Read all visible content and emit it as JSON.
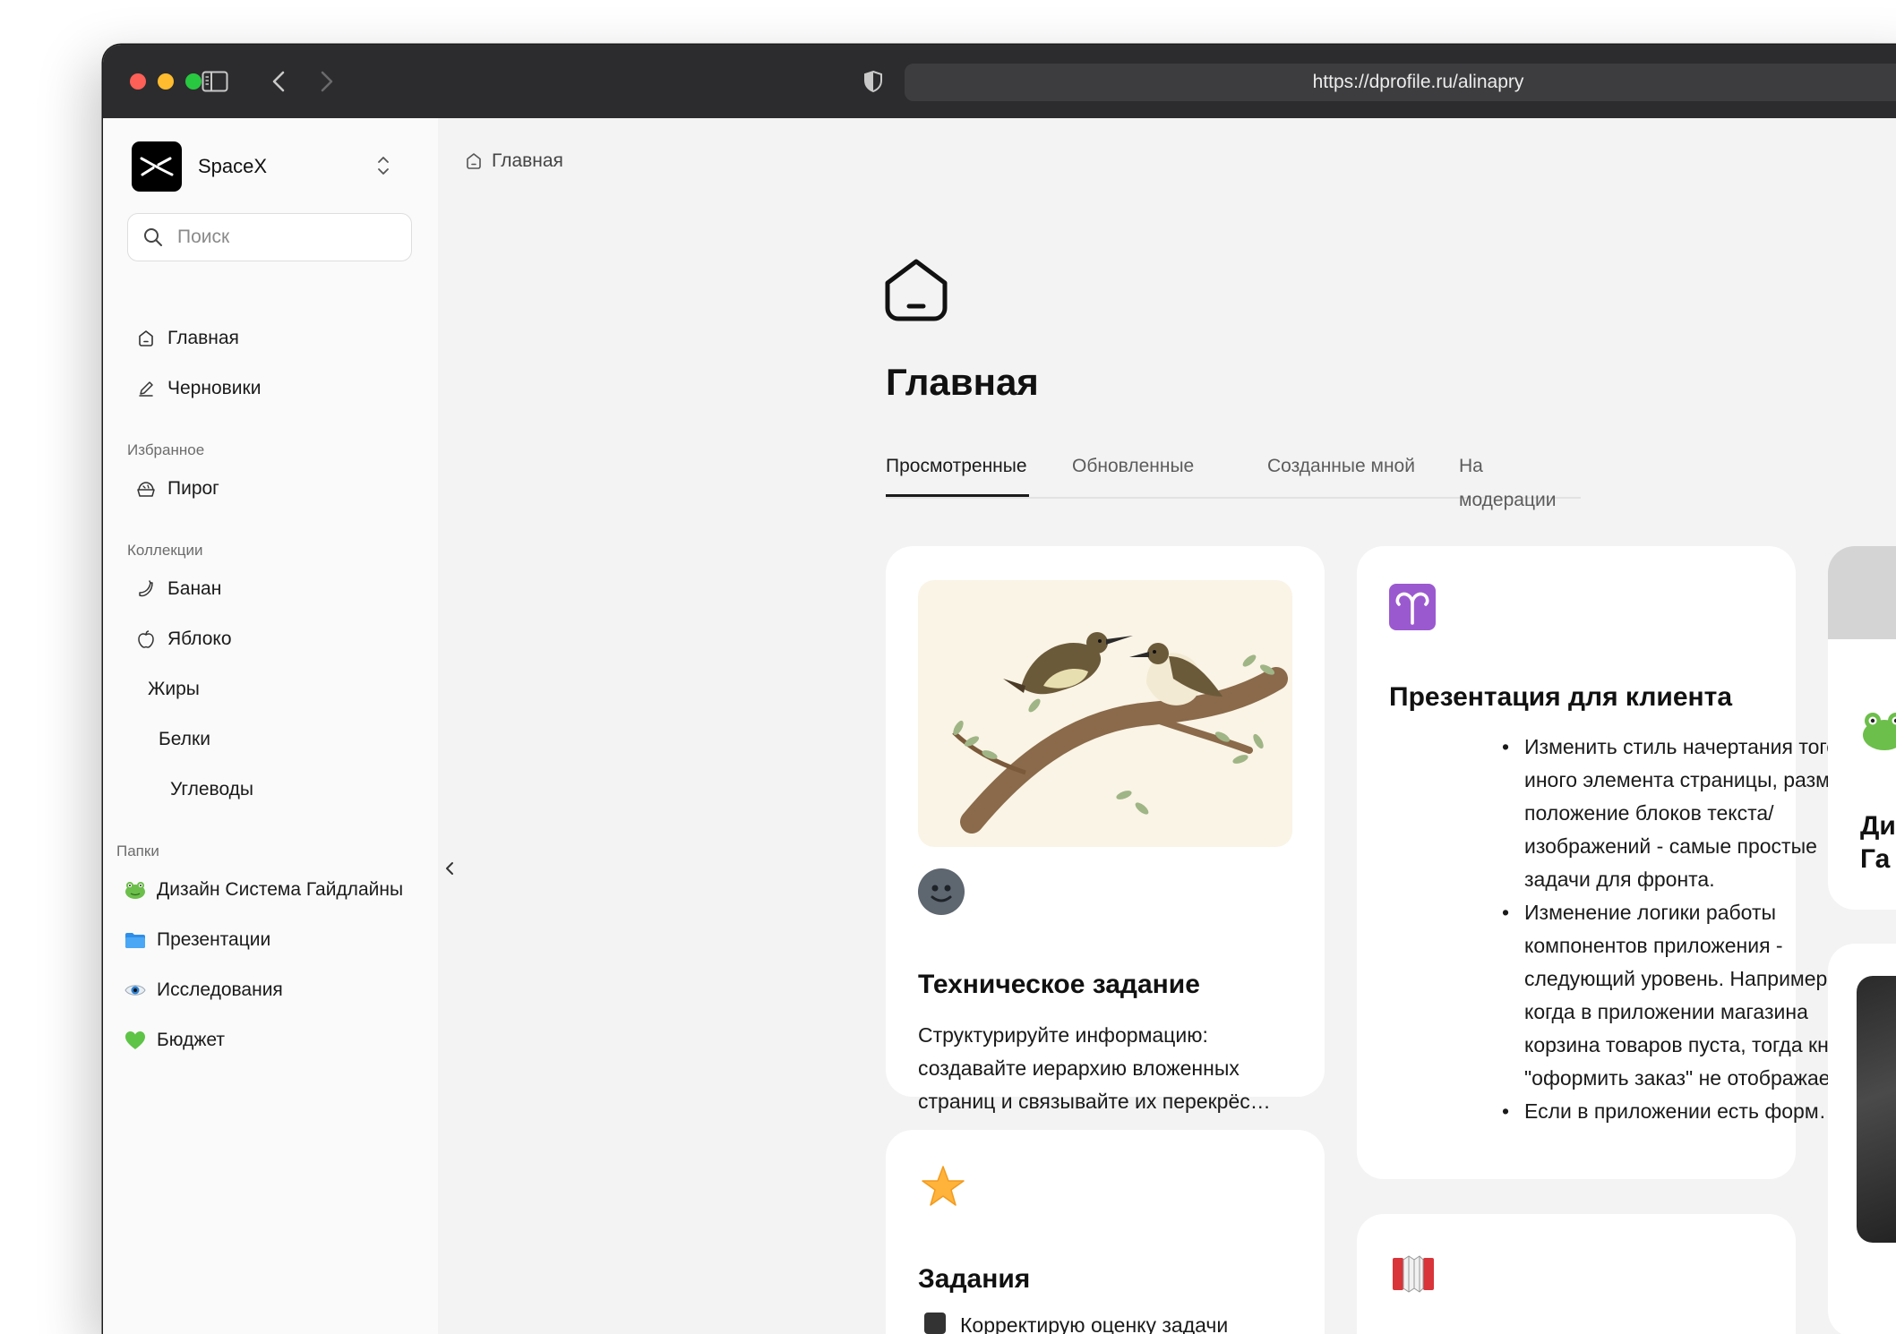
{
  "browser": {
    "url": "https://dprofile.ru/alinapry"
  },
  "sidebar": {
    "workspace": {
      "name": "SpaceX",
      "logo_icon": "x-logo"
    },
    "search": {
      "placeholder": "Поиск"
    },
    "main_items": [
      {
        "label": "Главная",
        "icon": "home-icon"
      },
      {
        "label": "Черновики",
        "icon": "pencil-icon"
      }
    ],
    "favorites": {
      "title": "Избранное",
      "items": [
        {
          "label": "Пирог",
          "icon": "pie-icon"
        }
      ]
    },
    "collections": {
      "title": "Коллекции",
      "items": [
        {
          "label": "Банан",
          "icon": "banana-icon"
        },
        {
          "label": "Яблоко",
          "icon": "apple-icon"
        },
        {
          "label": "Жиры"
        },
        {
          "label": "Белки"
        },
        {
          "label": "Углеводы"
        }
      ]
    },
    "folders": {
      "title": "Папки",
      "items": [
        {
          "label": "Дизайн Система Гайдлайны",
          "icon": "frog-emoji"
        },
        {
          "label": "Презентации",
          "icon": "folder-emoji"
        },
        {
          "label": "Исследования",
          "icon": "eye-emoji"
        },
        {
          "label": "Бюджет",
          "icon": "green-heart-emoji"
        }
      ]
    }
  },
  "main": {
    "breadcrumb": "Главная",
    "page_title": "Главная",
    "tabs": [
      {
        "label": "Просмотренные",
        "active": true
      },
      {
        "label": "Обновленные",
        "active": false
      },
      {
        "label": "Созданные мной",
        "active": false
      },
      {
        "label": "На модерации",
        "active": false
      }
    ],
    "cards": [
      {
        "title": "Техническое задание",
        "icon": "smiley-face-icon",
        "cover": "birds-on-branch-illustration",
        "text": "Структурируйте информацию: создавайте иерархию вложенных страниц и связывайте их перекрёс…"
      },
      {
        "title": "Презентация для клиента",
        "icon": "aries-sign-icon",
        "bullets": [
          "Изменить стиль начертания того или иного элемента страницы, размер и положение блоков текста/изображений - самые простые задачи для фронта.",
          "Изменение логики работы компонентов приложения - следующий уровень. Например: когда в приложении магазина корзина товаров пуста, тогда кнопка \"оформить заказ\" не отображается.",
          "Если в приложении есть форм…"
        ]
      },
      {
        "title": "Задания",
        "icon": "star-emoji",
        "checklist_first": "Корректирую оценку задачи"
      },
      {
        "icon": "accordion-emoji"
      },
      {
        "title_partial": "Ди Га",
        "icon": "frog-emoji"
      }
    ]
  },
  "colors": {
    "titlebar": "#2c2c2e",
    "sidebar_bg": "#fafafa",
    "content_bg": "#f3f3f3",
    "card_bg": "#ffffff",
    "aries_purple": "#9b59d0",
    "traffic_red": "#fe5f57",
    "traffic_yellow": "#febc2e",
    "traffic_green": "#28c840"
  }
}
